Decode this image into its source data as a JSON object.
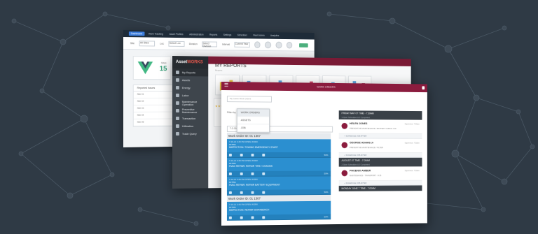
{
  "dashboard": {
    "nav_tabs": [
      "Dashboard",
      "Work Tracking",
      "Asset Profiles",
      "Administration",
      "Reports",
      "Settings",
      "Scheduler",
      "Fleet Admin",
      "Analytics"
    ],
    "filters": [
      {
        "label": "Site",
        "value": "All Sites"
      },
      {
        "label": "Loc",
        "value": "Select Loc"
      },
      {
        "label": "Division",
        "value": "Select Division"
      },
      {
        "label": "Interval",
        "value": "Current Year"
      }
    ],
    "tile": {
      "title": "Sites",
      "count": "15"
    },
    "table": {
      "header": "Reported Issues",
      "rows": [
        "Site 01",
        "Site 02",
        "Site 03",
        "Site 04",
        "Site 05"
      ]
    }
  },
  "reports": {
    "brand_prefix": "Asset",
    "brand_accent": "WORKS",
    "title": "MY REPORTS",
    "subtitle": "Reports",
    "menu": [
      "My Reports",
      "Assets",
      "Energy",
      "Labor",
      "Maintenance Operation",
      "Preventive Maintenance",
      "Transaction",
      "Utilization",
      "Trade Query"
    ]
  },
  "workorders": {
    "top_title": "WORK ORDERS",
    "filter_placeholder": "My Latest Work Orders",
    "filter_label": "Filter by",
    "dropdown_options": [
      "WORK ORDERS",
      "ASSETS",
      "JOB"
    ],
    "search_value": "7-2-2021",
    "groups": [
      {
        "title": "Work Order ID: 01 1367",
        "cards": [
          {
            "l1": "7-16-21 3:45 PM  OPEN WORK",
            "l2": "#27891",
            "l3": "INSPECTION: TOWING EMERGENCY START",
            "pct": "50%"
          },
          {
            "l1": "7-16-21 3:45 PM  OPEN WORK",
            "l2": "#27891",
            "l3": "HVAC REPAIR: REPAIR TIRE / CHASSIS",
            "pct": "50%"
          },
          {
            "l1": "7-16-21 3:45 PM  OPEN WORK",
            "l2": "#27891",
            "l3": "HVAC REPAIR: REPAIR BATTERY EQUIPMENT",
            "pct": "50%"
          }
        ]
      },
      {
        "title": "Work Order ID: 01 1367",
        "cards": [
          {
            "l1": "7-16-21 3:45 PM  OPEN WORK",
            "l2": "#27891",
            "l3": "INSPECTION: REPAIR WORKBENCH",
            "pct": "50%"
          }
        ]
      }
    ],
    "schedule": [
      {
        "date": "FRIDAY MAY 07 TIME - 7:30AM",
        "sub": "3 Open Schedules & 0 Completed",
        "name": "HELEN JONES",
        "desc": "PREVENTIVE MAINTENANCE / BATTERY CHECK 7:30",
        "right": "Supervisor: 7:30am",
        "action": "+ SCHEDULE JOB AFTER"
      },
      {
        "date": "",
        "sub": "",
        "name": "GEORGE ADAMS Jr",
        "desc": "PREVENTIVE MAINTENANCE / FILTER",
        "right": "Supervisor: 7:30am",
        "action": "+ SCHEDULE JOB AFTER"
      },
      {
        "date": "AUGUST 07 TIME - 7:00AM",
        "sub": "2 Open Schedules & 0 Completed",
        "name": "PHOENIX AMBER",
        "desc": "MAINTENANCE - TRANSPORT - 9:15",
        "right": "Supervisor: 7:00am",
        "action": "+ SCHEDULE JOB AFTER"
      },
      {
        "date": "MONDAY JUNE 7 TIME - 7:00AM",
        "sub": "",
        "name": "",
        "desc": "",
        "right": "",
        "action": ""
      }
    ]
  },
  "colors": {
    "background": "#2f3a45",
    "crimson": "#8b1c3e",
    "card_blue": "#2b8fd0",
    "accent_green": "#2e9b73"
  }
}
